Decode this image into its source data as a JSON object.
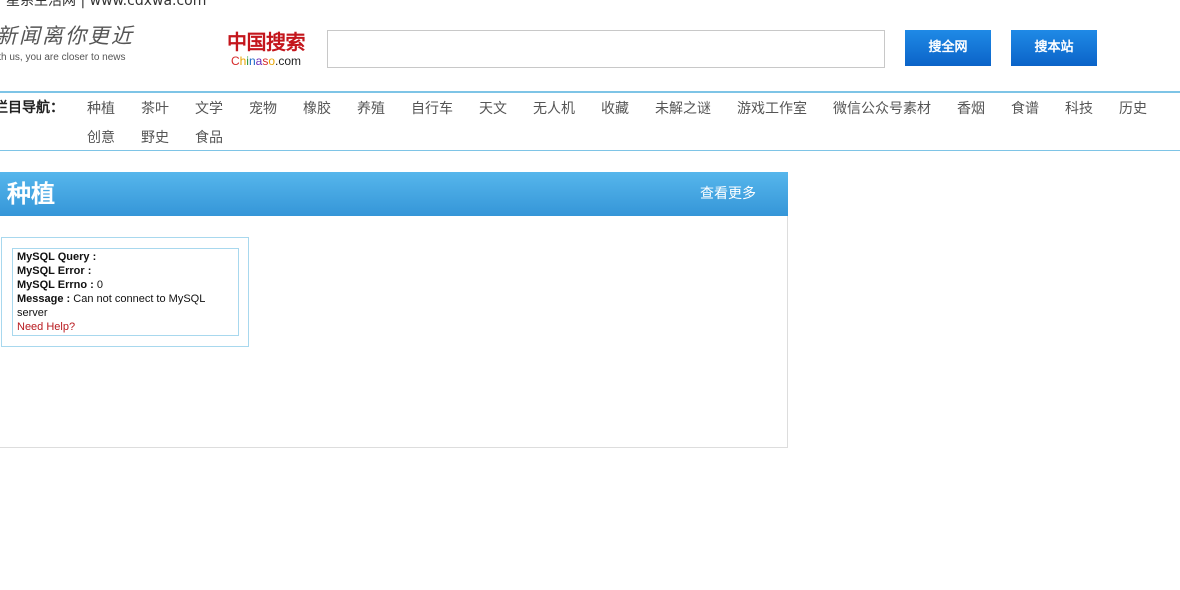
{
  "site": {
    "title": "星系生活网 | www.cdxwa.com"
  },
  "logo": {
    "main": "新闻离你更近",
    "sub": "ith us, you are closer to news"
  },
  "brand": {
    "cn": "中国搜索",
    "en_parts": [
      "C",
      "h",
      "i",
      "n",
      "a",
      "s",
      "o"
    ],
    "en_suffix": ".com"
  },
  "search": {
    "value": "",
    "placeholder": "",
    "btn_all": "搜全网",
    "btn_site": "搜本站"
  },
  "colors": {
    "brand_red": "#c4161c",
    "button_blue": "#0b63c8",
    "nav_line": "#7ec4e6",
    "section_header": "#3596d8",
    "error_link": "#b8191e"
  },
  "nav": {
    "label": "栏目导航：",
    "items": [
      "种植",
      "茶叶",
      "文学",
      "宠物",
      "橡胶",
      "养殖",
      "自行车",
      "天文",
      "无人机",
      "收藏",
      "未解之谜",
      "游戏工作室",
      "微信公众号素材",
      "香烟",
      "食谱",
      "科技",
      "历史",
      "创意",
      "野史",
      "食品"
    ]
  },
  "section": {
    "title": "种植",
    "more": "查看更多"
  },
  "error": {
    "query_label": "MySQL Query :",
    "query_value": "",
    "error_label": "MySQL Error :",
    "error_value": "",
    "errno_label": "MySQL Errno :",
    "errno_value": "0",
    "message_label": "Message :",
    "message_value": "Can not connect to MySQL server",
    "help": "Need Help?"
  }
}
